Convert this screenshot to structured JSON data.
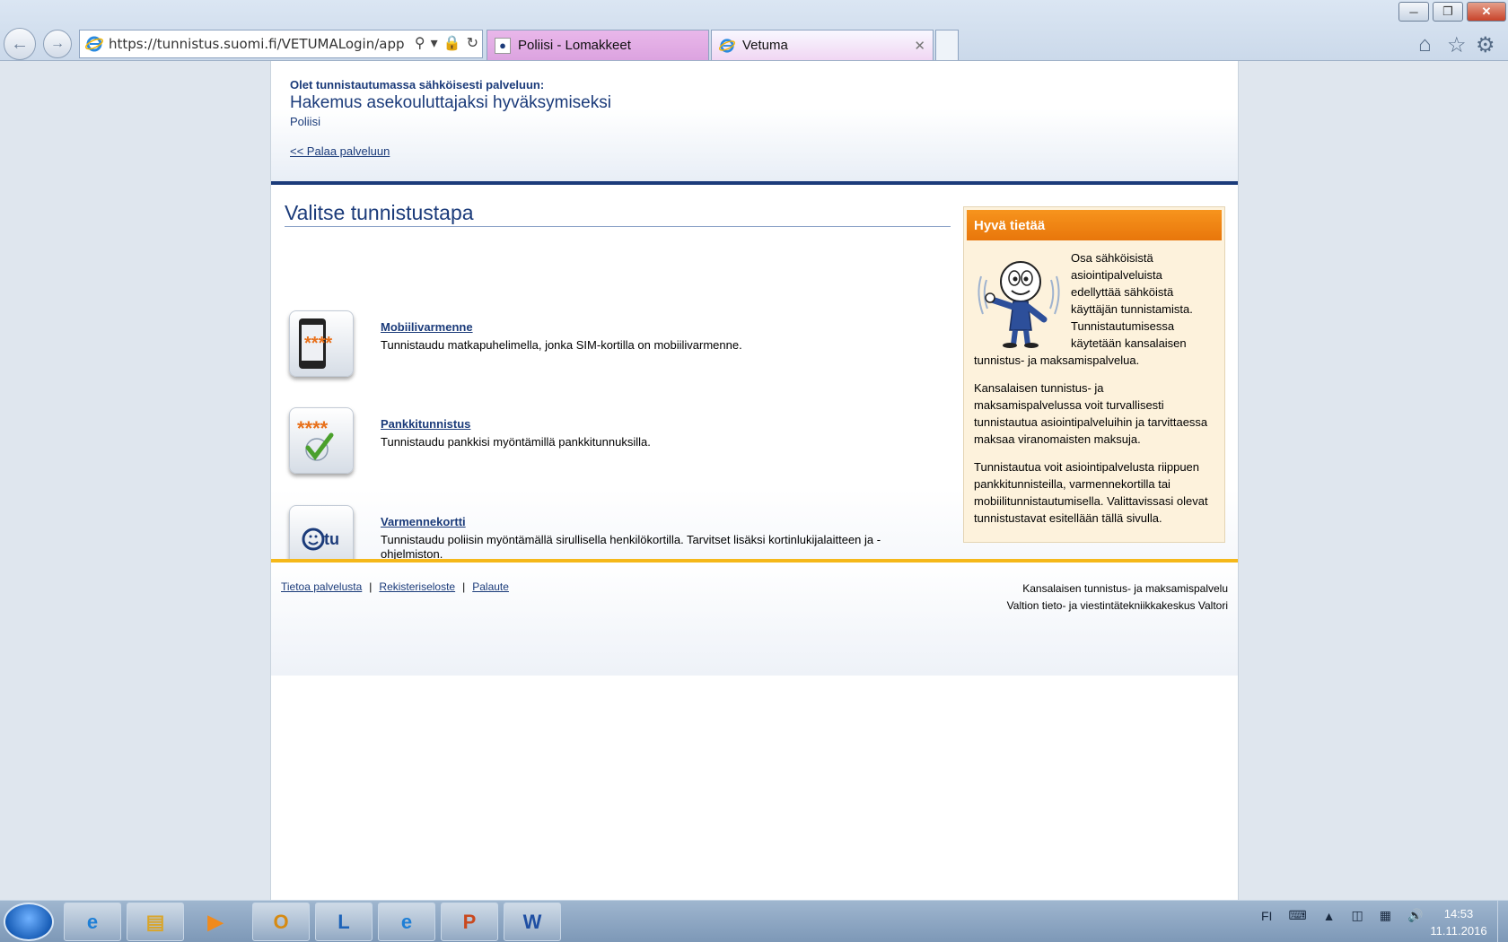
{
  "browser": {
    "address_url": "https://tunnistus.suomi.fi/VETUMALogin/app",
    "tabs": [
      {
        "label": "Poliisi - Lomakkeet"
      },
      {
        "label": "Vetuma"
      }
    ]
  },
  "header": {
    "intro": "Olet tunnistautumassa sähköisesti palveluun:",
    "service_name": "Hakemus asekouluttajaksi hyväksymiseksi",
    "organization": "Poliisi",
    "back_link": "<< Palaa palveluun"
  },
  "main": {
    "title": "Valitse tunnistustapa",
    "methods": [
      {
        "name": "Mobiilivarmenne",
        "description": "Tunnistaudu matkapuhelimella, jonka SIM-kortilla on mobiilivarmenne.",
        "icon": "mobile-phone-icon"
      },
      {
        "name": "Pankkitunnistus",
        "description": "Tunnistaudu pankkisi myöntämillä pankkitunnuksilla.",
        "icon": "bank-check-icon"
      },
      {
        "name": "Varmennekortti",
        "description": "Tunnistaudu poliisin myöntämällä sirullisella henkilökortilla. Tarvitset lisäksi kortinlukijalaitteen ja -ohjelmiston.",
        "icon": "id-card-icon"
      }
    ]
  },
  "info": {
    "title": "Hyvä tietää",
    "paragraphs": [
      "Osa sähköisistä asiointipalveluista edellyttää sähköistä käyttäjän tunnistamista. Tunnistautumisessa käytetään kansalaisen tunnistus- ja maksamispalvelua.",
      "Kansalaisen tunnistus- ja maksamispalvelussa voit turvallisesti tunnistautua asiointipalveluihin ja tarvittaessa maksaa viranomaisten maksuja.",
      "Tunnistautua voit asiointipalvelusta riippuen pankkitunnisteilla, varmennekortilla tai mobiilitunnistautumisella. Valittavissasi olevat tunnistustavat esitellään tällä sivulla."
    ]
  },
  "footer": {
    "links": [
      "Tietoa palvelusta",
      "Rekisteriseloste",
      "Palaute"
    ],
    "separator": "|",
    "right_line1": "Kansalaisen tunnistus- ja maksamispalvelu",
    "right_line2": "Valtion tieto- ja viestintätekniikkakeskus Valtori"
  },
  "taskbar": {
    "language": "FI",
    "time": "14:53",
    "date": "11.11.2016"
  },
  "colors": {
    "brand_blue": "#1b3b7a",
    "info_orange": "#f7941d",
    "footer_yellow": "#f5b81a",
    "info_bg": "#fdf2dc"
  }
}
